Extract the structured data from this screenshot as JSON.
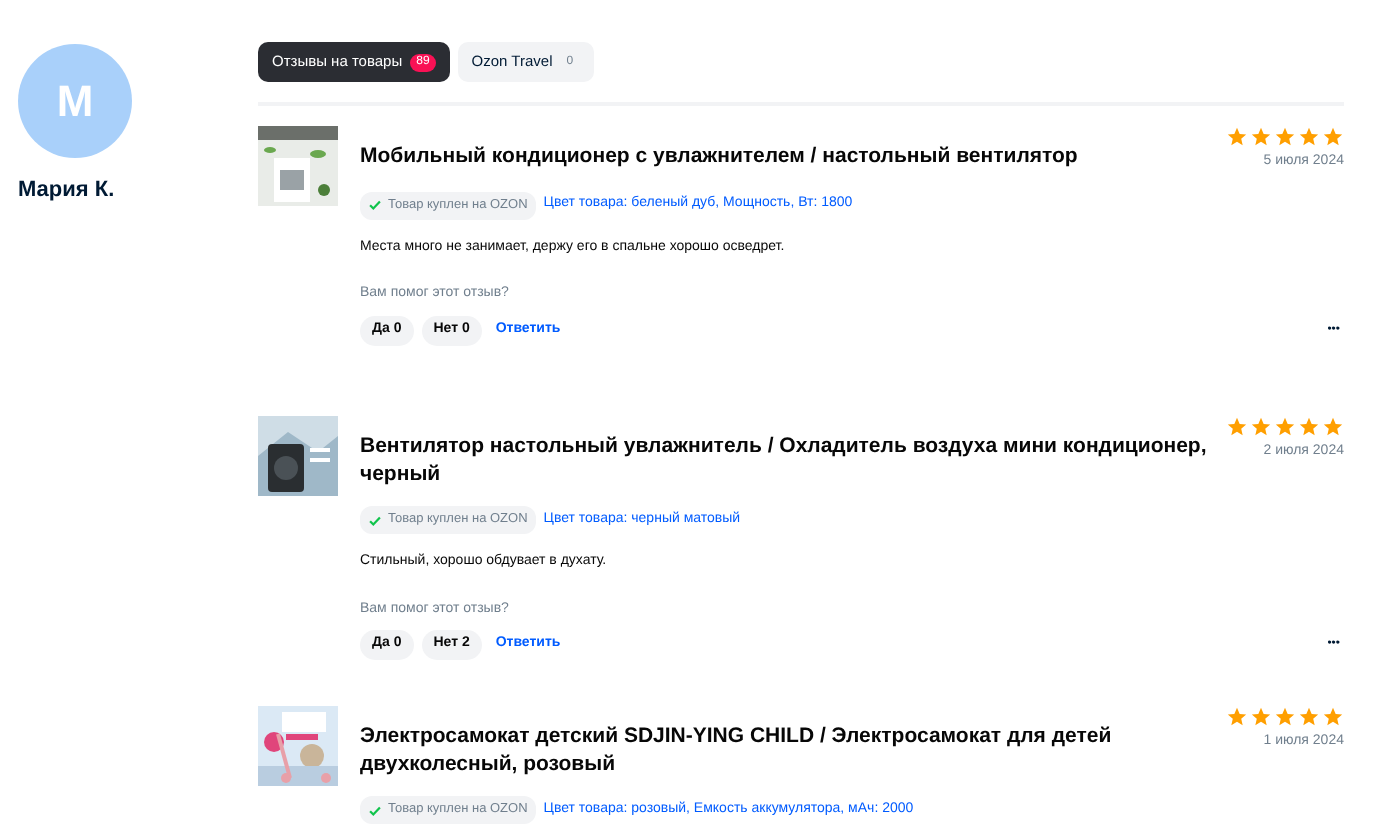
{
  "profile": {
    "initial": "М",
    "name": "Мария К."
  },
  "tabs": [
    {
      "label": "Отзывы на товары",
      "count": "89",
      "selected": true
    },
    {
      "label": "Ozon Travel",
      "count": "0",
      "selected": false
    }
  ],
  "reviews": [
    {
      "title": "Мобильный кондиционер с увлажнителем / настольный вентилятор",
      "stars": 5,
      "date": "5 июля 2024",
      "badge": "Товар куплен на OZON",
      "variant": "Цвет товара: беленый дуб, Мощность, Вт: 1800",
      "text": "Места много не занимает, держу его в спальне хорошо осведрет.",
      "helpful": "Вам помог этот отзыв?",
      "yes": "Да 0",
      "no": "Нет 0",
      "reply": "Ответить",
      "more": "•••"
    },
    {
      "title": "Вентилятор настольный увлажнитель / Охладитель воздуха мини кондиционер, черный",
      "stars": 5,
      "date": "2 июля 2024",
      "badge": "Товар куплен на OZON",
      "variant": "Цвет товара: черный матовый",
      "text": "Стильный, хорошо обдувает в духату.",
      "helpful": "Вам помог этот отзыв?",
      "yes": "Да 0",
      "no": "Нет 2",
      "reply": "Ответить",
      "more": "•••"
    },
    {
      "title": "Электросамокат детский SDJIN-YING CHILD / Электросамокат для детей двухколесный, розовый",
      "stars": 5,
      "date": "1 июля 2024",
      "badge": "Товар куплен на OZON",
      "variant": "Цвет товара: розовый, Емкость аккумулятора, мАч: 2000"
    }
  ]
}
